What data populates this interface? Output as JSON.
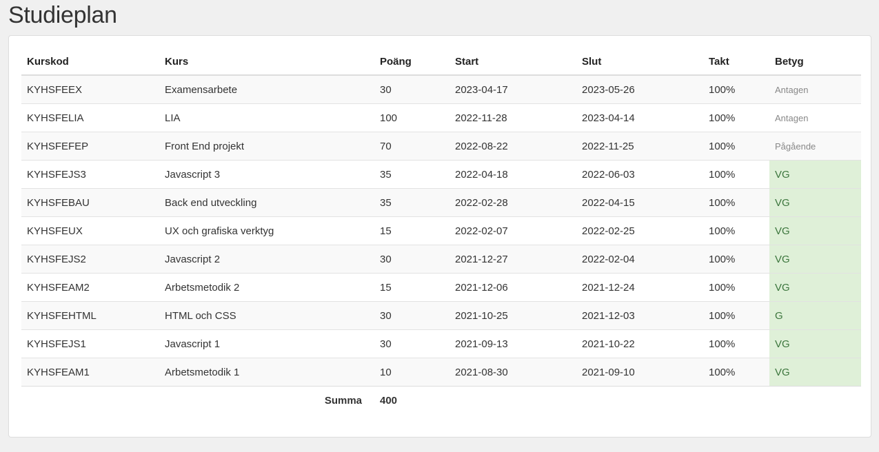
{
  "page": {
    "title": "Studieplan"
  },
  "table": {
    "headers": {
      "code": "Kurskod",
      "name": "Kurs",
      "points": "Poäng",
      "start": "Start",
      "end": "Slut",
      "pace": "Takt",
      "grade": "Betyg"
    },
    "rows": [
      {
        "code": "KYHSFEEX",
        "name": "Examensarbete",
        "points": "30",
        "start": "2023-04-17",
        "end": "2023-05-26",
        "pace": "100%",
        "grade": "Antagen"
      },
      {
        "code": "KYHSFELIA",
        "name": "LIA",
        "points": "100",
        "start": "2022-11-28",
        "end": "2023-04-14",
        "pace": "100%",
        "grade": "Antagen"
      },
      {
        "code": "KYHSFEFEP",
        "name": "Front End projekt",
        "points": "70",
        "start": "2022-08-22",
        "end": "2022-11-25",
        "pace": "100%",
        "grade": "Pågående"
      },
      {
        "code": "KYHSFEJS3",
        "name": "Javascript 3",
        "points": "35",
        "start": "2022-04-18",
        "end": "2022-06-03",
        "pace": "100%",
        "grade": "VG"
      },
      {
        "code": "KYHSFEBAU",
        "name": "Back end utveckling",
        "points": "35",
        "start": "2022-02-28",
        "end": "2022-04-15",
        "pace": "100%",
        "grade": "VG"
      },
      {
        "code": "KYHSFEUX",
        "name": "UX och grafiska verktyg",
        "points": "15",
        "start": "2022-02-07",
        "end": "2022-02-25",
        "pace": "100%",
        "grade": "VG"
      },
      {
        "code": "KYHSFEJS2",
        "name": "Javascript 2",
        "points": "30",
        "start": "2021-12-27",
        "end": "2022-02-04",
        "pace": "100%",
        "grade": "VG"
      },
      {
        "code": "KYHSFEAM2",
        "name": "Arbetsmetodik 2",
        "points": "15",
        "start": "2021-12-06",
        "end": "2021-12-24",
        "pace": "100%",
        "grade": "VG"
      },
      {
        "code": "KYHSFEHTML",
        "name": "HTML och CSS",
        "points": "30",
        "start": "2021-10-25",
        "end": "2021-12-03",
        "pace": "100%",
        "grade": "G"
      },
      {
        "code": "KYHSFEJS1",
        "name": "Javascript 1",
        "points": "30",
        "start": "2021-09-13",
        "end": "2021-10-22",
        "pace": "100%",
        "grade": "VG"
      },
      {
        "code": "KYHSFEAM1",
        "name": "Arbetsmetodik 1",
        "points": "10",
        "start": "2021-08-30",
        "end": "2021-09-10",
        "pace": "100%",
        "grade": "VG"
      }
    ],
    "footer": {
      "sum_label": "Summa",
      "sum_value": "400"
    }
  },
  "colors": {
    "final_grade_bg": "#dff0d8",
    "final_grade_text": "#3c763d",
    "status_text": "#888888"
  }
}
